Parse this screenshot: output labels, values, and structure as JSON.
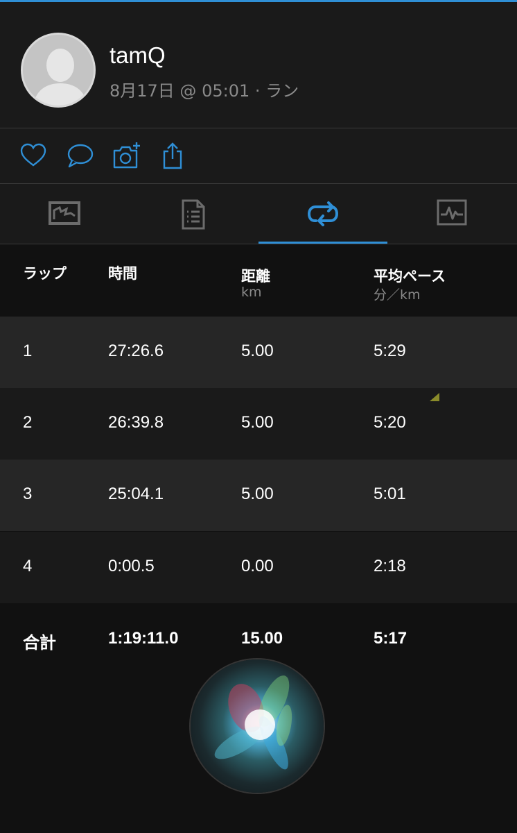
{
  "header": {
    "username": "tamQ",
    "subtitle": "8月17日 @ 05:01 · ラン"
  },
  "actions": [
    "heart-icon",
    "comment-icon",
    "add-photo-icon",
    "share-icon"
  ],
  "tabs": [
    "overview-tab",
    "details-tab",
    "laps-tab",
    "stats-tab"
  ],
  "active_tab": "laps-tab",
  "accent_color": "#2f8fd6",
  "table": {
    "columns": [
      {
        "label": "ラップ",
        "unit": ""
      },
      {
        "label": "時間",
        "unit": ""
      },
      {
        "label": "距離",
        "unit": "km"
      },
      {
        "label": "平均ペース",
        "unit": "分／km"
      }
    ],
    "rows": [
      [
        "1",
        "27:26.6",
        "5.00",
        "5:29"
      ],
      [
        "2",
        "26:39.8",
        "5.00",
        "5:20"
      ],
      [
        "3",
        "25:04.1",
        "5.00",
        "5:01"
      ],
      [
        "4",
        "0:00.5",
        "0.00",
        "2:18"
      ]
    ],
    "total": [
      "合計",
      "1:19:11.0",
      "15.00",
      "5:17"
    ]
  }
}
